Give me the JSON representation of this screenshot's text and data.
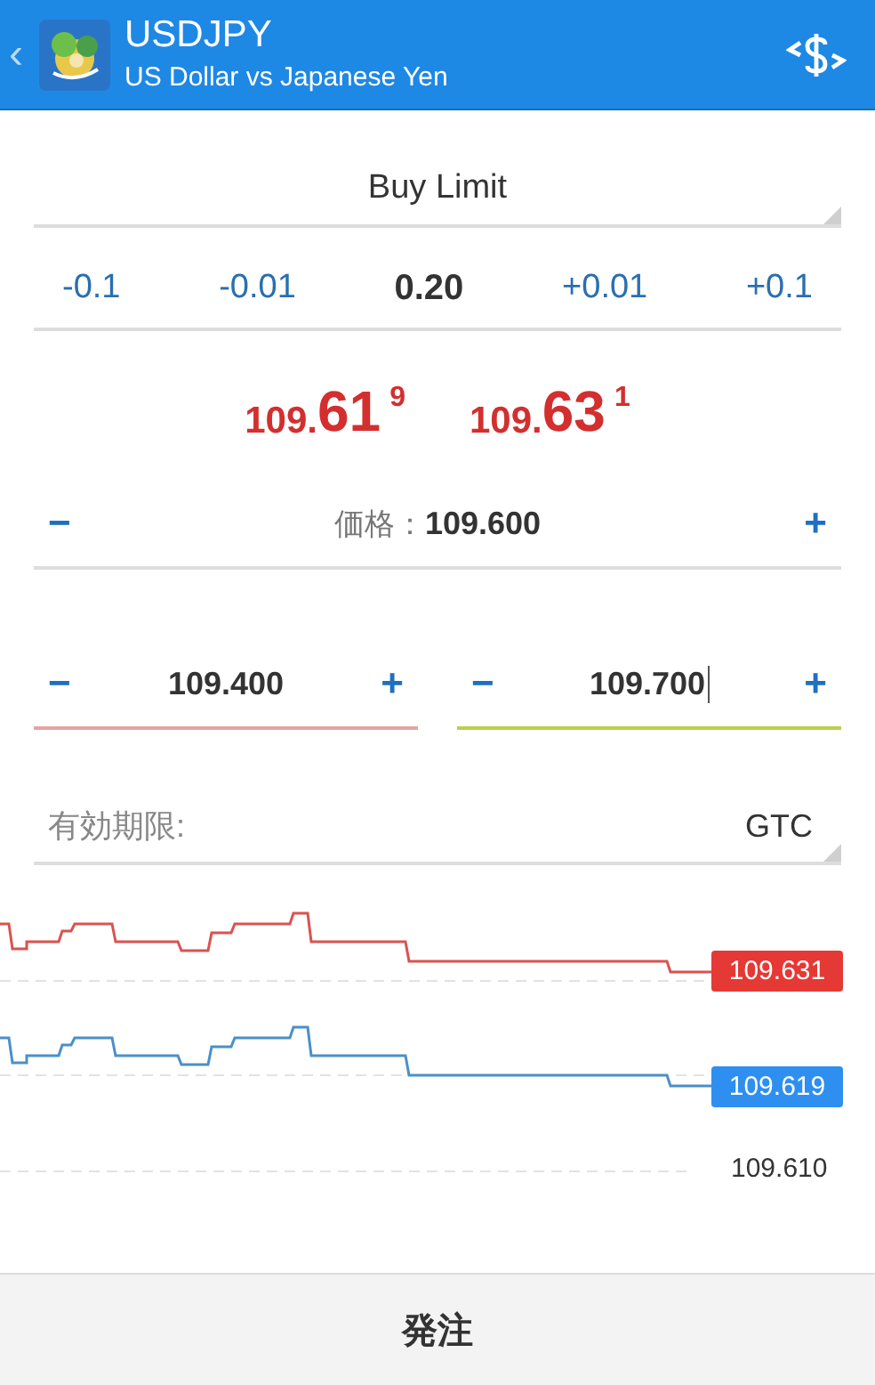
{
  "header": {
    "back": "‹",
    "symbol": "USDJPY",
    "description": "US Dollar vs Japanese Yen"
  },
  "order_type": {
    "value": "Buy Limit"
  },
  "volume_steps": [
    {
      "label": "-0.1",
      "kind": "step"
    },
    {
      "label": "-0.01",
      "kind": "step"
    },
    {
      "label": "0.20",
      "kind": "value"
    },
    {
      "label": "+0.01",
      "kind": "step"
    },
    {
      "label": "+0.1",
      "kind": "step"
    }
  ],
  "quotes": [
    {
      "small": "109.",
      "big": "61",
      "sup": "9"
    },
    {
      "small": "109.",
      "big": "63",
      "sup": "1"
    }
  ],
  "price_field": {
    "minus": "−",
    "label": "価格：",
    "value": "109.600",
    "plus": "+"
  },
  "level_fields": [
    {
      "minus": "−",
      "value": "109.400",
      "plus": "+",
      "color": "#e6a3a3",
      "focused": false
    },
    {
      "minus": "−",
      "value": "109.700",
      "plus": "+",
      "color": "#bcd04a",
      "focused": true
    }
  ],
  "expiry": {
    "label": "有効期限:",
    "value": "GTC"
  },
  "chart": {
    "ask_tag": "109.631",
    "bid_tag": "109.619",
    "axis_label": "109.610"
  },
  "submit": "発注"
}
